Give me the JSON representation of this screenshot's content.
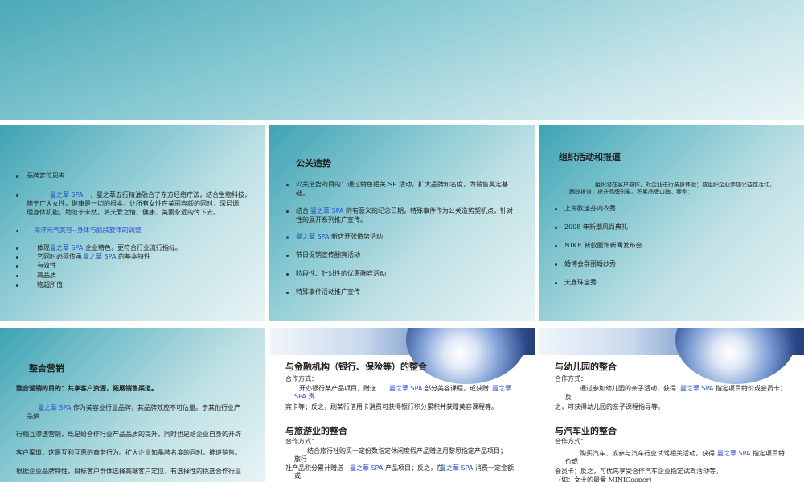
{
  "s1": {
    "items": [
      "品牌定位思考",
      "曼之華 SPA",
      "，曼之華五行精油融合了东方经络疗法，结合生物科技，",
      "施于广大女性。健康是一切的根本，让所有女性在美丽容颜的同时，深层调",
      "理身体机能，助范于未然，将天爱之情、健康、美丽永远的传下去。",
      "海洋元气美容--身体与肌肤旋律的调整",
      "体现",
      "曼之華 SPA",
      " 企业特色，更符合行业流行指标。",
      "它同时必须传承",
      "曼之華 SPA",
      " 的基本特性",
      "有效性",
      "高品质",
      "物超所值"
    ]
  },
  "s2": {
    "title": "公关造势",
    "items": [
      "公关造势的目的：通过特色相关 SP 活动，扩大品牌知名度，为销售奠定基",
      "础。",
      "结合",
      "曼之華 SPA",
      " 的有意义的纪念日期，特殊事件作为公关造势契机点，针对",
      "性的展开系列推广宣传。",
      "曼之華 SPA",
      " 新店开张造势活动",
      "节日促销宣传酬宾活动",
      "阶段性、针对性的优惠酬宾活动",
      "特殊事件活动推广宣传"
    ]
  },
  "s3": {
    "title": "组织活动和报道",
    "intro1": "组织潜在客户群体，对企业进行亲身体验；或组织企业参加公益性活动，",
    "intro2": "跟踪报道，提升品牌形象。积累品牌口碑。案例：",
    "items": [
      "上海欧迪芬内衣秀",
      "2008 年新潮风尚典礼",
      "NIKE 新款服饰新闻发布会",
      "婚博会群丽婚纱秀",
      "天鑫珠宝秀"
    ]
  },
  "s4": {
    "title": "整合营销",
    "purpose": "整合营销的目的：共享客户资源，拓展销售渠道。",
    "lines": [
      "曼之華 SPA",
      " 作为美容业行业品牌，其品牌效应不可估量。于其他行业产",
      "品进",
      "行相互渗透营销，既是给合作行业产品品质的提升，同时也是给企业自身的开辟",
      "客户渠道，这是互利互惠的商务行为。扩大企业知晶牌名度的同时，推进销售。",
      "根据企业品牌特性，目标客户群体选择高端客户定位，有选择性的挑选合作行业"
    ]
  },
  "s5": {
    "h1": "与金融机构（银行、保险等）的整合",
    "coop": "合作方式：",
    "l1a": "开办银行某产品项目，赠送",
    "l1b": "曼之華 SPA",
    "l1c": " 部分美容课程，或获赠",
    "l1d": "曼之華",
    "l2": "SPA 贵",
    "l3": "宾卡等；反之，刷某行信用卡消费可获得银行积分累积并获赠美容课程等。",
    "h2": "与旅游业的整合",
    "coop2": "合作方式：",
    "m1": "结合旅行社购买一定份数指定休闲度假产品赠送月黎思指定产品项目；",
    "m2": "旅行",
    "m3a": "社产品积分累计赠送",
    "m3b": "曼之華 SPA",
    "m3c": " 产品项目；反之，在",
    "m3d": "曼之華 SPA",
    "m3e": " 消费一定金额",
    "m4": "或"
  },
  "s6": {
    "h1": "与幼儿园的整合",
    "coop": "合作方式：",
    "l1a": "通过参加幼儿园的亲子活动，获得",
    "l1b": "曼之華 SPA",
    "l1c": " 指定项目特价或会员卡；",
    "l2": "反",
    "l3": "之，可获得幼儿园的亲子课程指导等。",
    "h2": "与汽车业的整合",
    "coop2": "合作方式：",
    "m1a": "购买汽车、或参与汽车行业试驾相关活动，获得",
    "m1b": "曼之華 SPA",
    "m1c": " 指定项目特",
    "m2": "价或",
    "m3": "会员卡；反之，可优先享受合作汽车企业指定试驾活动等。",
    "m4": "（如：女士的最爱 MINICooper）"
  }
}
